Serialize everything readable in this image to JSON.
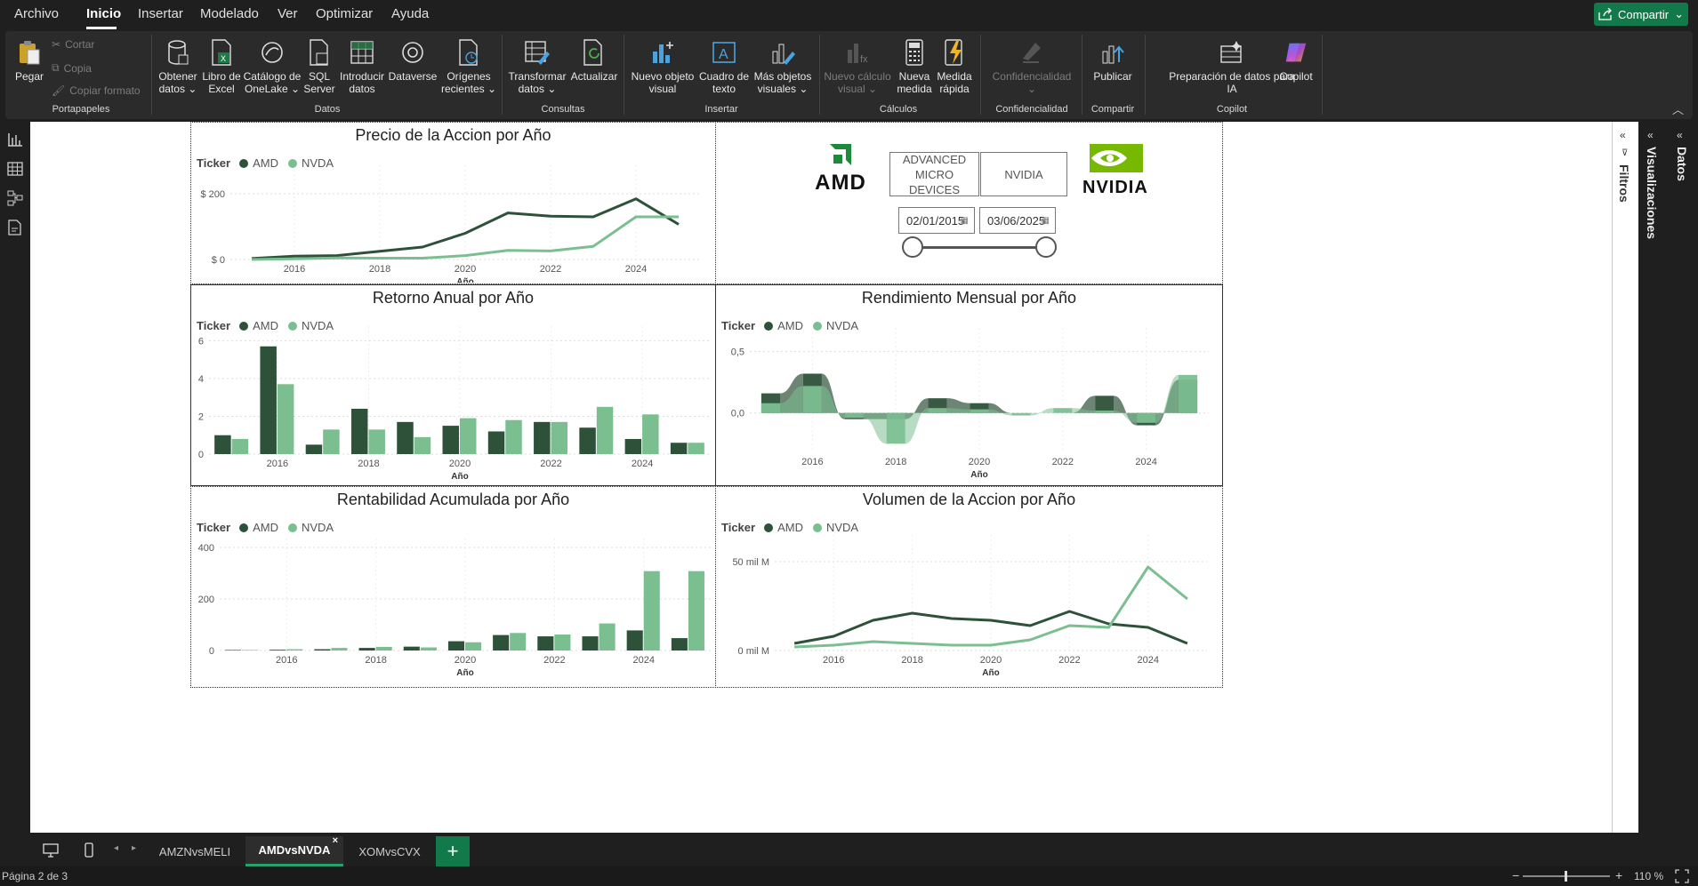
{
  "menu": [
    "Archivo",
    "Inicio",
    "Insertar",
    "Modelado",
    "Ver",
    "Optimizar",
    "Ayuda"
  ],
  "share_label": "Compartir",
  "ribbon": {
    "paste": "Pegar",
    "cut": "Cortar",
    "copy": "Copia",
    "format_painter": "Copiar formato",
    "get_data": [
      "Obtener",
      "datos"
    ],
    "excel": [
      "Libro de",
      "Excel"
    ],
    "onelake": [
      "Catálogo de",
      "OneLake"
    ],
    "sql": [
      "SQL",
      "Server"
    ],
    "enter_data": [
      "Introducir",
      "datos"
    ],
    "dataverse": "Dataverse",
    "recent": [
      "Orígenes",
      "recientes"
    ],
    "transform": [
      "Transformar",
      "datos"
    ],
    "refresh": "Actualizar",
    "new_visual": [
      "Nuevo objeto",
      "visual"
    ],
    "text_box": [
      "Cuadro de",
      "texto"
    ],
    "more_visuals": [
      "Más objetos",
      "visuales"
    ],
    "new_calc": [
      "Nuevo cálculo",
      "visual"
    ],
    "new_measure": [
      "Nueva",
      "medida"
    ],
    "quick_measure": [
      "Medida",
      "rápida"
    ],
    "sensitivity": "Confidencialidad",
    "publish": "Publicar",
    "prep_ai": [
      "Preparación de datos para",
      "IA"
    ],
    "copilot": "Copilot",
    "groups": [
      "Portapapeles",
      "Datos",
      "Consultas",
      "Insertar",
      "Cálculos",
      "Confidencialidad",
      "Compartir",
      "Copilot"
    ]
  },
  "legend": {
    "title": "Ticker",
    "amd": "AMD",
    "nvda": "NVDA"
  },
  "colors": {
    "amd": "#2d5139",
    "nvda": "#7bbf91",
    "accent": "#127a4a"
  },
  "header_panel": {
    "amd_logo": "AMD",
    "nvidia_logo": "NVIDIA",
    "btn_amd": [
      "ADVANCED",
      "MICRO DEVICES"
    ],
    "btn_nvda": "NVIDIA",
    "date_start": "02/01/2015",
    "date_end": "03/06/2025",
    "slider_range": [
      0,
      1
    ]
  },
  "chart_data": [
    {
      "type": "line",
      "title": "Precio de la Accion por Año",
      "xlabel": "Año",
      "x": [
        2015,
        2016,
        2017,
        2018,
        2019,
        2020,
        2021,
        2022,
        2023,
        2024,
        2025
      ],
      "xticks": [
        "2016",
        "2018",
        "2020",
        "2022",
        "2024"
      ],
      "yticks": [
        "$ 0",
        "$ 200"
      ],
      "ylim": [
        0,
        260
      ],
      "series": [
        {
          "name": "AMD",
          "values": [
            3,
            10,
            12,
            25,
            38,
            80,
            142,
            132,
            130,
            185,
            107
          ]
        },
        {
          "name": "NVDA",
          "values": [
            0,
            2,
            5,
            4,
            4,
            12,
            28,
            26,
            40,
            130,
            130
          ]
        }
      ]
    },
    {
      "type": "bar",
      "title": "Retorno Anual por Año",
      "xlabel": "Año",
      "categories": [
        "2015",
        "2016",
        "2017",
        "2018",
        "2019",
        "2020",
        "2021",
        "2022",
        "2023",
        "2024",
        "2025"
      ],
      "xticks": [
        "2016",
        "2018",
        "2020",
        "2022",
        "2024"
      ],
      "yticks": [
        "0",
        "2",
        "4",
        "6"
      ],
      "ylim": [
        0,
        6.3
      ],
      "series": [
        {
          "name": "AMD",
          "values": [
            1.0,
            5.7,
            0.5,
            2.4,
            1.7,
            1.5,
            1.2,
            1.7,
            1.4,
            0.8,
            0.6
          ]
        },
        {
          "name": "NVDA",
          "values": [
            0.8,
            3.7,
            1.3,
            1.3,
            0.9,
            1.9,
            1.8,
            1.7,
            2.5,
            2.1,
            0.6
          ]
        }
      ]
    },
    {
      "type": "area",
      "title": "Rendimiento Mensual por Año",
      "xlabel": "Año",
      "categories": [
        "2015",
        "2016",
        "2017",
        "2018",
        "2019",
        "2020",
        "2021",
        "2022",
        "2023",
        "2024",
        "2025"
      ],
      "xticks": [
        "2016",
        "2018",
        "2020",
        "2022",
        "2024"
      ],
      "yticks": [
        "0,0",
        "0,5"
      ],
      "ylim": [
        -0.32,
        0.62
      ],
      "series": [
        {
          "name": "AMD",
          "values": [
            0.16,
            0.32,
            -0.05,
            -0.05,
            0.12,
            0.08,
            0.0,
            0.0,
            0.14,
            -0.1,
            0.27
          ]
        },
        {
          "name": "NVDA",
          "values": [
            0.08,
            0.22,
            -0.04,
            -0.25,
            0.04,
            0.03,
            -0.02,
            0.04,
            0.02,
            -0.08,
            0.31
          ]
        }
      ]
    },
    {
      "type": "bar",
      "title": "Rentabilidad Acumulada por Año",
      "xlabel": "Año",
      "categories": [
        "2015",
        "2016",
        "2017",
        "2018",
        "2019",
        "2020",
        "2021",
        "2022",
        "2023",
        "2024",
        "2025"
      ],
      "xticks": [
        "2016",
        "2018",
        "2020",
        "2022",
        "2024"
      ],
      "yticks": [
        "0",
        "200",
        "400"
      ],
      "ylim": [
        0,
        400
      ],
      "series": [
        {
          "name": "AMD",
          "values": [
            2,
            3,
            5,
            10,
            15,
            36,
            60,
            55,
            55,
            78,
            48
          ]
        },
        {
          "name": "NVDA",
          "values": [
            2,
            5,
            10,
            14,
            12,
            32,
            68,
            62,
            105,
            308,
            308
          ]
        }
      ]
    },
    {
      "type": "line",
      "title": "Volumen de la Accion por Año",
      "xlabel": "Año",
      "x": [
        2015,
        2016,
        2017,
        2018,
        2019,
        2020,
        2021,
        2022,
        2023,
        2024,
        2025
      ],
      "xticks": [
        "2016",
        "2018",
        "2020",
        "2022",
        "2024"
      ],
      "yticks": [
        "0 mil M",
        "50 mil M"
      ],
      "ylim": [
        0,
        60
      ],
      "series": [
        {
          "name": "AMD",
          "values": [
            4,
            8,
            17,
            21,
            18,
            17,
            14,
            22,
            15,
            13,
            4
          ]
        },
        {
          "name": "NVDA",
          "values": [
            2,
            3,
            5,
            4,
            3,
            3,
            6,
            14,
            13,
            47,
            29
          ]
        }
      ]
    }
  ],
  "tabs": [
    "AMZNvsMELI",
    "AMDvsNVDA",
    "XOMvsCVX"
  ],
  "panes": {
    "filters": "Filtros",
    "visuals": "Visualizaciones",
    "data": "Datos"
  },
  "status": {
    "page": "Página 2 de 3",
    "zoom": "110 %"
  }
}
